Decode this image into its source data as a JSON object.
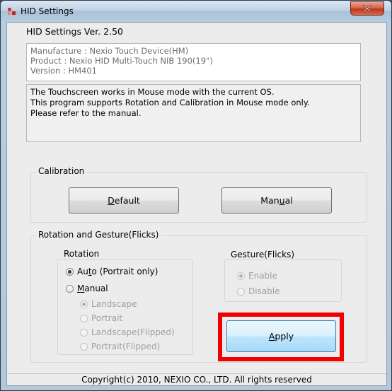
{
  "window": {
    "title": "HID Settings"
  },
  "header": {
    "version_label": "HID Settings Ver. 2.50"
  },
  "device_info": {
    "manufacture": "Manufacture : Nexio Touch Device(HM)",
    "product": "Product : Nexio HID Multi-Touch NIB 190(19\")",
    "version": "Version : HM401"
  },
  "notice": {
    "line1": "The Touchscreen works in Mouse mode with the current OS.",
    "line2": "This program supports Rotation and Calibration in Mouse mode only.",
    "line3": "Please refer to the manual."
  },
  "calibration": {
    "label": "Calibration",
    "default_button": {
      "prefix": "",
      "underline": "D",
      "suffix": "efault"
    },
    "manual_button": {
      "prefix": "Man",
      "underline": "u",
      "suffix": "al"
    }
  },
  "rotation_gesture": {
    "label": "Rotation and Gesture(Flicks)",
    "rotation": {
      "label": "Rotation",
      "auto": {
        "prefix": "Au",
        "underline": "t",
        "suffix": "o (Portrait only)",
        "checked": true
      },
      "manual": {
        "prefix": "",
        "underline": "M",
        "suffix": "anual",
        "checked": false
      },
      "sub_options": [
        {
          "label": "Landscape",
          "checked": true
        },
        {
          "label": "Portrait",
          "checked": false
        },
        {
          "label": "Landscape(Flipped)",
          "checked": false
        },
        {
          "label": "Portrait(Flipped)",
          "checked": false
        }
      ]
    },
    "gesture": {
      "label": "Gesture(Flicks)",
      "enable": "Enable",
      "disable": "Disable",
      "enable_checked": true
    },
    "apply_button": {
      "prefix": "",
      "underline": "A",
      "suffix": "pply"
    }
  },
  "footer": {
    "copyright": "Copyright(c) 2010, NEXIO CO., LTD. All rights reserved"
  },
  "colors": {
    "highlight": "#f00000",
    "close_button": "#c2361a"
  }
}
